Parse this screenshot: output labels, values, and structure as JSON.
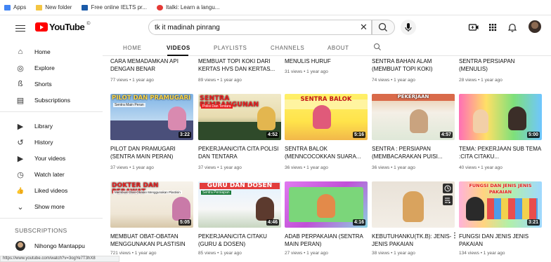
{
  "bookmarks": [
    {
      "label": "Apps",
      "color": "#4285f4"
    },
    {
      "label": "New folder",
      "color": "#f4c542"
    },
    {
      "label": "Free online IELTS pr...",
      "color": "#1a5aa8"
    },
    {
      "label": "Italki: Learn a langu...",
      "color": "#e53935"
    }
  ],
  "header": {
    "logo_text": "YouTube",
    "logo_region": "ID",
    "search_value": "tk it madinah pinrang",
    "clear_glyph": "✕"
  },
  "sidebar": {
    "items": [
      {
        "label": "Home",
        "icon": "home-icon",
        "glyph": "⌂"
      },
      {
        "label": "Explore",
        "icon": "compass-icon",
        "glyph": "◎"
      },
      {
        "label": "Shorts",
        "icon": "shorts-icon",
        "glyph": "ß"
      },
      {
        "label": "Subscriptions",
        "icon": "subscriptions-icon",
        "glyph": "▤"
      },
      {
        "label": "Library",
        "icon": "library-icon",
        "glyph": "▶"
      },
      {
        "label": "History",
        "icon": "history-icon",
        "glyph": "↺"
      },
      {
        "label": "Your videos",
        "icon": "your-videos-icon",
        "glyph": "▶"
      },
      {
        "label": "Watch later",
        "icon": "clock-icon",
        "glyph": "◷"
      },
      {
        "label": "Liked videos",
        "icon": "thumbs-up-icon",
        "glyph": "👍"
      },
      {
        "label": "Show more",
        "icon": "chevron-down-icon",
        "glyph": "⌄"
      }
    ],
    "subscriptions_heading": "SUBSCRIPTIONS",
    "subscriptions": [
      {
        "label": "Nihongo Mantappu"
      }
    ]
  },
  "tabs": [
    {
      "label": "HOME"
    },
    {
      "label": "VIDEOS"
    },
    {
      "label": "PLAYLISTS"
    },
    {
      "label": "CHANNELS"
    },
    {
      "label": "ABOUT"
    }
  ],
  "top_row": [
    {
      "title": "CARA MEMADAMKAN API DENGAN BENAR",
      "meta": "77 views • 1 year ago"
    },
    {
      "title": "MEMBUAT TOPI KOKI DARI KERTAS HVS DAN KERTAS...",
      "meta": "89 views • 1 year ago"
    },
    {
      "title": "MENULIS HURUF",
      "meta": "31 views • 1 year ago"
    },
    {
      "title": "SENTRA BAHAN ALAM (MEMBUAT TOPI KOKI)",
      "meta": "74 views • 1 year ago"
    },
    {
      "title": "SENTRA PERSIAPAN (MENULIS)",
      "meta": "28 views • 1 year ago"
    }
  ],
  "row2": [
    {
      "title": "PILOT DAN PRAMUGARI (SENTRA MAIN PERAN)",
      "meta": "37 views • 1 year ago",
      "duration": "3:22",
      "thumb_text": "PILOT DAN PRAMUGARI",
      "thumb_sub": "Sentra Main Peran"
    },
    {
      "title": "PEKERJAAN/CITA CITA POLISI DAN TENTARA",
      "meta": "37 views • 1 year ago",
      "duration": "4:52",
      "thumb_text": "SENTRA PEMBANGUNAN",
      "thumb_sub": "Polisi Dan Tentara"
    },
    {
      "title": "SENTRA BALOK (MENNCOCOKKAN SUARA...",
      "meta": "36 views • 1 year ago",
      "duration": "5:16",
      "thumb_text": "SENTRA BALOK",
      "thumb_sub": ""
    },
    {
      "title": "SENTRA : PERSIAPAN (MEMBACARAKAN PUISI...",
      "meta": "36 views • 1 year ago",
      "duration": "4:57",
      "thumb_text": "PEKERJAAN",
      "thumb_sub": ""
    },
    {
      "title": "TEMA: PEKERJAAN SUB TEMA :CITA CITAKU...",
      "meta": "40 views • 1 year ago",
      "duration": "5:00",
      "thumb_text": "",
      "thumb_sub": ""
    }
  ],
  "row3": [
    {
      "title": "MEMBUAT OBAT-OBATAN MENGGUNAKAN PLASTISIN",
      "meta": "721 views • 1 year ago",
      "duration": "5:05",
      "thumb_text": "DOKTER DAN PERAWAT",
      "thumb_sub": "Membuat Obat-Obatan Menggunakan Plastisin"
    },
    {
      "title": "PEKERJAAN/CITA CITAKU (GURU & DOSEN)",
      "meta": "85 views • 1 year ago",
      "duration": "4:46",
      "thumb_text": "GURU DAN DOSEN",
      "thumb_sub": "Sentra Persiapan"
    },
    {
      "title": "ADAB PERPAKAIAN (SENTRA MAIN PERAN)",
      "meta": "27 views • 1 year ago",
      "duration": "4:16",
      "thumb_text": "",
      "thumb_sub": ""
    },
    {
      "title": "KEBUTUHANKU(TK.B): JENIS-JENIS PAKAIAN",
      "meta": "38 views • 1 year ago",
      "duration": "",
      "thumb_text": "",
      "thumb_sub": ""
    },
    {
      "title": "FUNGSI DAN JENIS JENIS PAKAIAN",
      "meta": "134 views • 1 year ago",
      "duration": "3:21",
      "thumb_text": "FUNGSI DAN JENIS JENIS PAKAIAN",
      "thumb_sub": ""
    }
  ],
  "status_url": "https://www.youtube.com/watch?v=3ogYe7T3hX8",
  "colors": {
    "brand": "#ff0000",
    "text": "#0f0f0f",
    "muted": "#606060"
  }
}
